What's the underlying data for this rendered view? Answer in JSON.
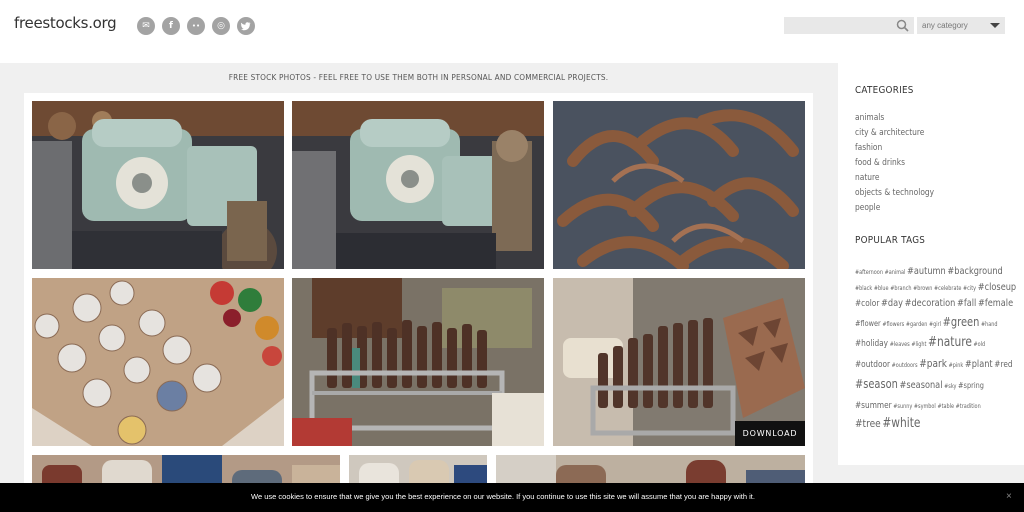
{
  "site": {
    "logo": "freestocks.org"
  },
  "header": {
    "social_icons": [
      "mail-icon",
      "facebook-icon",
      "flickr-icon",
      "instagram-icon",
      "twitter-icon"
    ],
    "social_glyphs": [
      "✉",
      "f",
      "••",
      "◎",
      "🐦"
    ],
    "search": {
      "value": "",
      "placeholder": ""
    },
    "category_select": {
      "selected": "any category"
    }
  },
  "main": {
    "tagline": "FREE STOCK PHOTOS - FEEL FREE TO USE THEM BOTH IN PERSONAL AND COMMERCIAL PROJECTS.",
    "download_label": "DOWNLOAD"
  },
  "sidebar": {
    "categories_title": "CATEGORIES",
    "categories": [
      "animals",
      "city & architecture",
      "fashion",
      "food & drinks",
      "nature",
      "objects & technology",
      "people"
    ],
    "tags_title": "POPULAR TAGS",
    "tag_lines": [
      [
        "#afternoon",
        "#animal",
        "#autumn",
        "#background"
      ],
      [
        "#black",
        "#blue",
        "#branch",
        "#brown",
        "#celebrate",
        "#city",
        "#closeup"
      ],
      [
        "#color",
        "#day",
        "#decoration",
        "#fall",
        "#female"
      ],
      [
        "#flower",
        "#flowers",
        "#garden",
        "#girl",
        "#green",
        "#hand"
      ],
      [
        "#holiday",
        "#leaves",
        "#light",
        "#nature",
        "#old"
      ],
      [
        "#outdoor",
        "#outdoors",
        "#park",
        "#pink",
        "#plant",
        "#red"
      ],
      [
        "#season",
        "#seasonal",
        "#sky",
        "#spring"
      ],
      [
        "#summer",
        "#sunny",
        "#symbol",
        "#table",
        "#tradition"
      ],
      [
        "#tree",
        "#white"
      ]
    ]
  },
  "cookie": {
    "text": "We use cookies to ensure that we give you the best experience on our website. If you continue to use this site we will assume that you are happy with it.",
    "close": "×"
  },
  "colors": {
    "background": "#f0f0f0",
    "cookie_bar": "#000000",
    "icon_grey": "#a3a3a3"
  }
}
